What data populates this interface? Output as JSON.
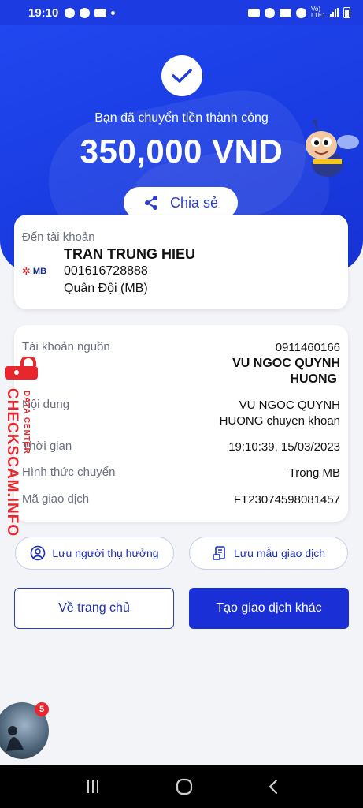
{
  "status_bar": {
    "time": "19:10",
    "network_label": "Vo) LTE1"
  },
  "hero": {
    "success_message": "Bạn đã chuyển tiền thành công",
    "amount": "350,000 VND",
    "share_label": "Chia sẻ"
  },
  "destination": {
    "label": "Đến tài khoản",
    "bank_logo_text": "MB",
    "name": "TRAN TRUNG HIEU",
    "account_number": "001616728888",
    "bank_name": "Quân Đội (MB)"
  },
  "details": {
    "source_label": "Tài khoản nguồn",
    "source_account": "0911460166",
    "source_name_line1": "VU NGOC QUYNH",
    "source_name_line2": "HUONG",
    "content_label": "Nội dung",
    "content_line1": "VU NGOC QUYNH",
    "content_line2": "HUONG chuyen khoan",
    "time_label": "Thời gian",
    "time_value": "19:10:39, 15/03/2023",
    "method_label": "Hình thức chuyển",
    "method_value": "Trong MB",
    "txn_label": "Mã giao dịch",
    "txn_value": "FT23074598081457"
  },
  "watermark": {
    "main": "CHECKSCAM.INFO",
    "sub": "DATA CENTER"
  },
  "actions": {
    "save_recipient": "Lưu người thụ hưởng",
    "save_template": "Lưu mẫu giao dịch",
    "home": "Về trang chủ",
    "new_transaction": "Tạo giao dịch khác"
  },
  "chat": {
    "badge_count": "5"
  },
  "colors": {
    "primary": "#1b2fd6",
    "accent_red": "#e8262d"
  }
}
